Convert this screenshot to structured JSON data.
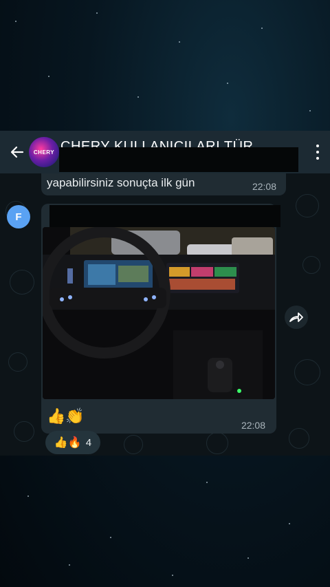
{
  "header": {
    "title": "CHERY KULLANICILARI TÜR",
    "avatar_text": "CHERY",
    "icons": {
      "back": "arrow-left-icon",
      "more": "more-vertical-icon"
    }
  },
  "messages": {
    "previous": {
      "text": "yapabilirsiniz sonuçta ilk gün",
      "time": "22:08"
    },
    "main": {
      "sender_initial": "F",
      "photo_description_icon": "car-interior-photo",
      "inline_reaction": "👍👏",
      "time": "22:08"
    }
  },
  "reactions": {
    "emojis": "👍🔥",
    "count": "4"
  },
  "colors": {
    "header_bg": "#1c2a33",
    "bubble_bg": "#202c33",
    "chat_bg": "#0d1418",
    "sender_avatar": "#5aa2f3"
  }
}
